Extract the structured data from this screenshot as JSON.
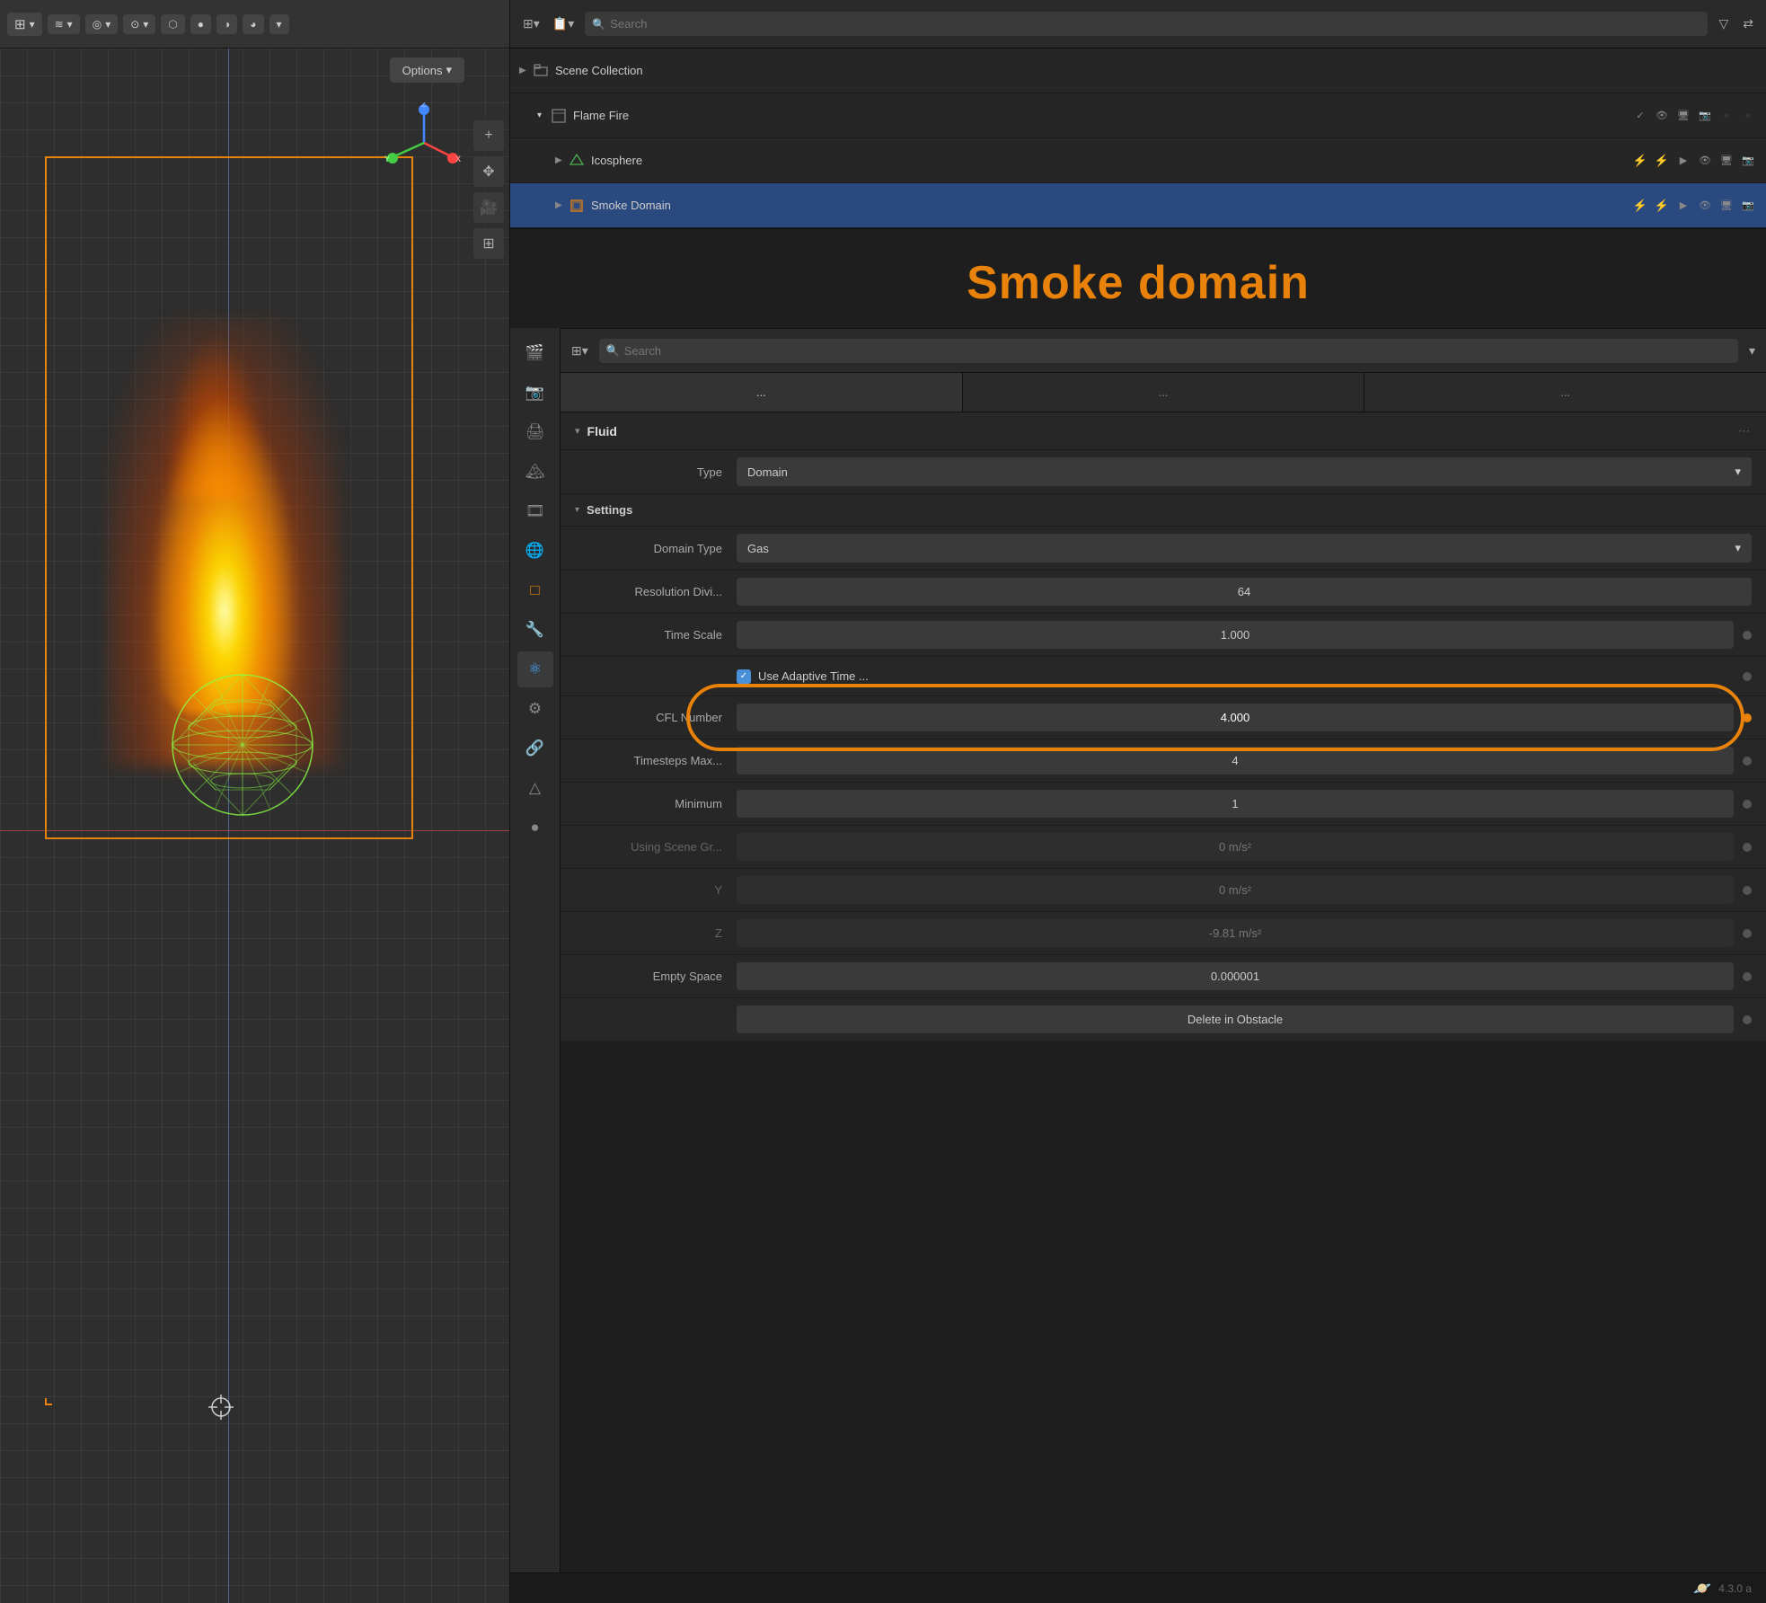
{
  "viewport": {
    "options_label": "Options",
    "options_arrow": "▾"
  },
  "outliner": {
    "search_placeholder": "Search",
    "filter_icon": "▾",
    "scene_collection_label": "Scene Collection",
    "items": [
      {
        "label": "Flame Fire",
        "indent": 1,
        "expanded": true,
        "icon": "🔥"
      },
      {
        "label": "Icosphere",
        "indent": 2,
        "icon": "△"
      },
      {
        "label": "Smoke Domain",
        "indent": 2,
        "icon": "◇",
        "selected": true
      }
    ]
  },
  "title": {
    "text": "Smoke domain"
  },
  "properties_header": {
    "search_placeholder": "Search"
  },
  "fluid_section": {
    "label": "Fluid",
    "type_label": "Type",
    "type_value": "Domain",
    "settings_label": "Settings",
    "domain_type_label": "Domain Type",
    "domain_type_value": "Gas",
    "resolution_label": "Resolution Divi...",
    "resolution_value": "64",
    "time_scale_label": "Time Scale",
    "time_scale_value": "1.000",
    "use_adaptive_label": "Use Adaptive Time ...",
    "cfl_label": "CFL Number",
    "cfl_value": "4.000",
    "timesteps_max_label": "Timesteps Max...",
    "timesteps_max_value": "4",
    "minimum_label": "Minimum",
    "minimum_value": "1",
    "gravity_x_label": "Using Scene Gr...",
    "gravity_x_value": "0 m/s²",
    "gravity_y_label": "Y",
    "gravity_y_value": "0 m/s²",
    "gravity_z_label": "Z",
    "gravity_z_value": "-9.81 m/s²",
    "empty_space_label": "Empty Space",
    "empty_space_value": "0.000001",
    "delete_obstacle_label": "Delete in Obstacle"
  },
  "sidebar_icons": {
    "scene_icon": "📷",
    "render_icon": "📷",
    "output_icon": "🖨",
    "view_layer_icon": "🏔",
    "scene2_icon": "🎬",
    "world_icon": "🌐",
    "object_icon": "□",
    "modifier_icon": "🔧",
    "particles_icon": "✦",
    "physics_icon": "⚛",
    "constraints_icon": "🔗",
    "data_icon": "📊",
    "material_icon": "●",
    "shader_icon": "◉"
  },
  "status": {
    "blender_icon": "🪐",
    "version": "4.3.0 a"
  }
}
